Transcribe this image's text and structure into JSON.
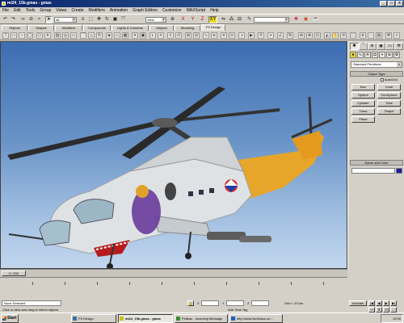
{
  "window": {
    "title": "mi24_15b.gmax - gmax",
    "min": "_",
    "max": "□",
    "close": "×"
  },
  "menu": [
    "File",
    "Edit",
    "Tools",
    "Group",
    "Views",
    "Create",
    "Modifiers",
    "Animation",
    "Graph Editors",
    "Customize",
    "MAXScript",
    "Help"
  ],
  "toolbar": {
    "selection_filter": "All",
    "ref_coord": "View",
    "named_selection": ""
  },
  "tabs": [
    "Objects",
    "Shapes",
    "Modifiers",
    "Compounds",
    "Lights & Cameras",
    "Helpers",
    "Modeling",
    "FS Design"
  ],
  "active_tab": "FS Design",
  "command_panel": {
    "category_dropdown": "Standard Primitives",
    "object_type_header": "Object Type",
    "autogrid_label": "AutoGrid",
    "buttons": [
      "Box",
      "Cone",
      "Sphere",
      "GeoSphere",
      "Cylinder",
      "Tube",
      "Torus",
      "Teapot",
      "Plane"
    ],
    "name_color_header": "Name and Color"
  },
  "time_slider": {
    "label": "0 / 200"
  },
  "status": {
    "selection": "None Selected",
    "prompt": "Click or click-and-drag to select objects",
    "grid": "Grid = 10.0m",
    "add_time_tag": "Add Time Tag",
    "animate": "Animate",
    "x_label": "X",
    "y_label": "Y",
    "z_label": "Z"
  },
  "taskbar": {
    "start": "Start",
    "items": [
      "FS Design",
      "mi24_15b.gmax - gmax",
      "Pelikan - Incoming Message",
      "http://www.fscheska.cz/..."
    ],
    "active_index": 1,
    "clock": "19:55"
  }
}
